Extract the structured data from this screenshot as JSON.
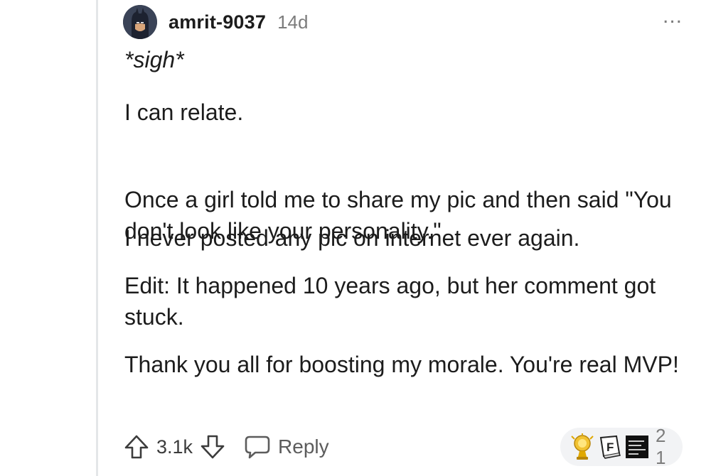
{
  "comment": {
    "author": "amrit-9037",
    "age": "14d",
    "more_label": "...",
    "paragraphs": [
      "*sigh*",
      "I can relate.",
      "Once a girl told me to share my pic and then said \"You don't look like your personality.\"",
      "I never posted any pic on internet ever again.",
      "Edit: It happened 10 years ago, but her comment got stuck.",
      "Thank you all for boosting my morale. You're real MVP!"
    ],
    "score": "3.1k",
    "reply_label": "Reply",
    "awards": {
      "icons": [
        "gold-trophy-icon",
        "letter-f-keycap-icon",
        "meme-text-icon"
      ],
      "count": "2 1"
    }
  },
  "colors": {
    "text": "#1c1c1c",
    "meta": "#7c7c7c",
    "thread_line": "#e4e6e8",
    "award_pill": "#f2f3f5"
  }
}
